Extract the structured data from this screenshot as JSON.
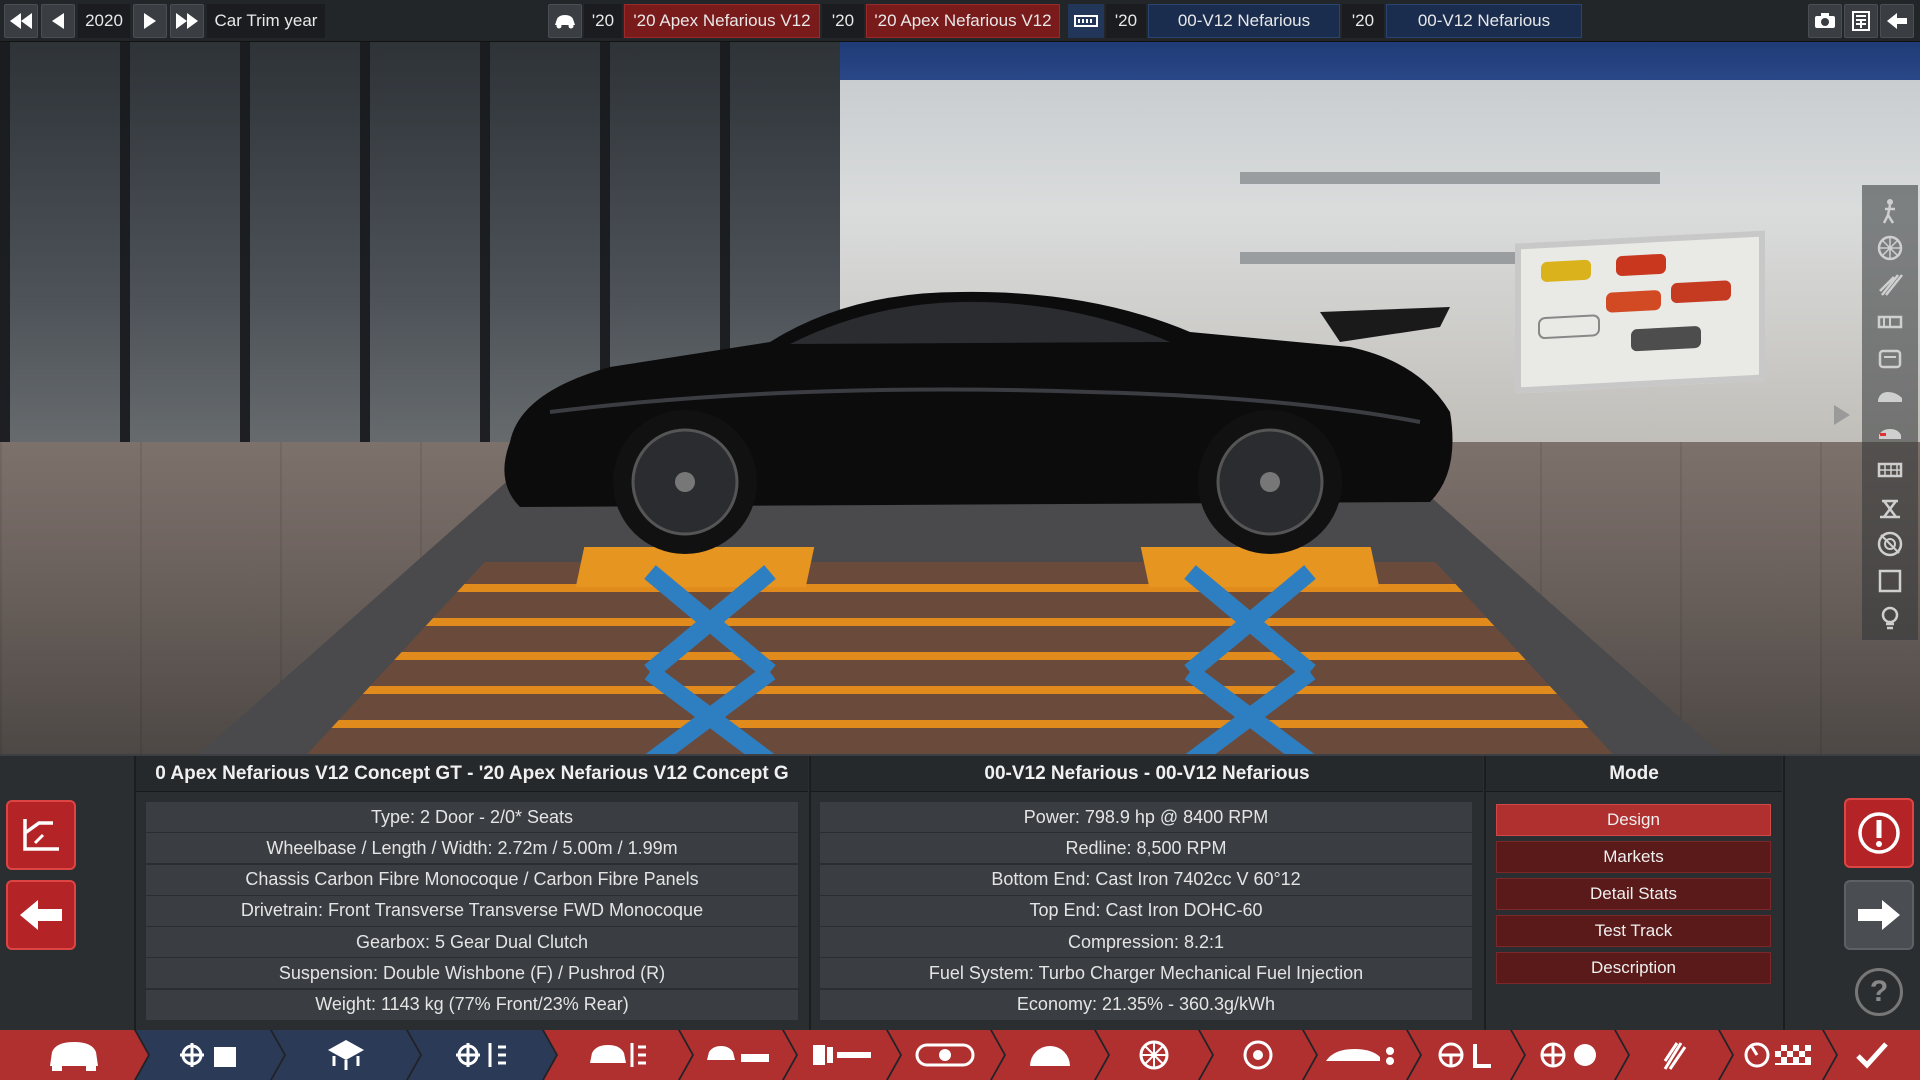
{
  "topbar": {
    "year": "2020",
    "year_label": "Car Trim year",
    "model_year": "'20",
    "model_name": "'20 Apex Nefarious V12",
    "trim_year": "'20",
    "trim_name": "'20 Apex Nefarious V12",
    "engine_family_year": "'20",
    "engine_family_name": "00-V12 Nefarious",
    "engine_variant_year": "'20",
    "engine_variant_name": "00-V12 Nefarious"
  },
  "icons": {
    "top_left": [
      "rewind-icon",
      "prev-icon",
      "next-icon",
      "fast-forward-icon"
    ],
    "top_right": [
      "camera-icon",
      "calculator-icon",
      "back-arrow-icon"
    ],
    "side_strip": [
      "figure-icon",
      "wheel-icon",
      "fixture-icon",
      "shock-icon",
      "brake-icon",
      "car-side-icon",
      "taillight-icon",
      "grille-icon",
      "jack-icon",
      "tire-icon",
      "frame-icon",
      "bulb-icon"
    ],
    "bottom_bar": [
      "car-model-icon",
      "engine-body-icon",
      "engine-icon",
      "engine-tuning-icon",
      "car-body-icon",
      "suspension-icon",
      "drivetrain-icon",
      "fuel-icon",
      "gears-icon",
      "wheel-icon",
      "brake-disc-icon",
      "aero-icon",
      "steering-interior-icon",
      "safety-icon",
      "test-icon",
      "final-icon",
      "checkmark-icon"
    ]
  },
  "car_panel": {
    "title": "0 Apex Nefarious V12 Concept GT - '20 Apex Nefarious V12 Concept G",
    "rows": [
      "Type: 2 Door - 2/0* Seats",
      "Wheelbase / Length / Width: 2.72m / 5.00m / 1.99m",
      "Chassis Carbon Fibre Monocoque / Carbon Fibre Panels",
      "Drivetrain: Front Transverse Transverse FWD Monocoque",
      "Gearbox: 5 Gear Dual Clutch",
      "Suspension: Double Wishbone (F) / Pushrod (R)",
      "Weight: 1143 kg (77% Front/23% Rear)"
    ]
  },
  "engine_panel": {
    "title": "00-V12 Nefarious - 00-V12 Nefarious",
    "rows": [
      "Power: 798.9 hp @ 8400 RPM",
      "Redline:  8,500 RPM",
      "Bottom End: Cast Iron 7402cc V 60°12",
      "Top End: Cast Iron DOHC-60",
      "Compression: 8.2:1",
      "Fuel System: Turbo Charger Mechanical Fuel Injection",
      "Economy: 21.35% - 360.3g/kWh"
    ]
  },
  "mode_panel": {
    "title": "Mode",
    "buttons": [
      "Design",
      "Markets",
      "Detail Stats",
      "Test Track",
      "Description"
    ],
    "active": "Design"
  },
  "help_label": "?",
  "colors": {
    "accent_red": "#b03030",
    "topbar_red": "#7a1b1b",
    "topbar_blue": "#1b2d4f",
    "active_category": "#b03030",
    "inactive_category": "#2a3a57"
  }
}
